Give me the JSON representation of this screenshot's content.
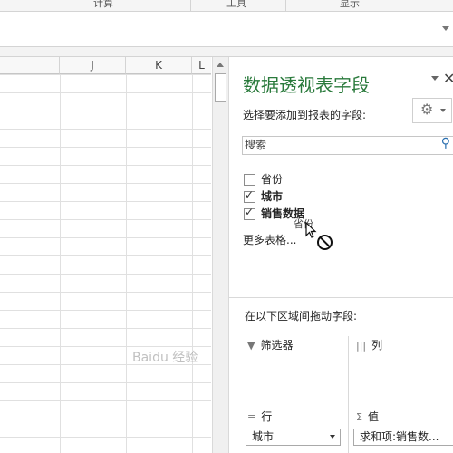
{
  "ribbon": {
    "groups": [
      "计算",
      "工具",
      "显示"
    ]
  },
  "grid": {
    "columns": [
      "J",
      "K",
      "L"
    ]
  },
  "pane": {
    "title": "数据透视表字段",
    "close_glyph": "✕",
    "choose_label": "选择要添加到报表的字段:",
    "gear_glyph": "⚙",
    "search_placeholder": "搜索",
    "search_icon_glyph": "⚲",
    "fields": [
      {
        "label": "省份",
        "checked": false
      },
      {
        "label": "城市",
        "checked": true
      },
      {
        "label": "销售数据",
        "checked": true
      }
    ],
    "more_tables": "更多表格...",
    "drag_ghost_label": "省份",
    "drag_hint": "在以下区域间拖动字段:",
    "areas": {
      "filter": {
        "label": "筛选器",
        "icon": "▼"
      },
      "columns": {
        "label": "列",
        "icon": "|||"
      },
      "rows": {
        "label": "行",
        "icon": "≡",
        "item": "城市"
      },
      "values": {
        "label": "值",
        "icon": "Σ",
        "item": "求和项:销售数..."
      }
    }
  },
  "watermark": "Baidu 经验"
}
